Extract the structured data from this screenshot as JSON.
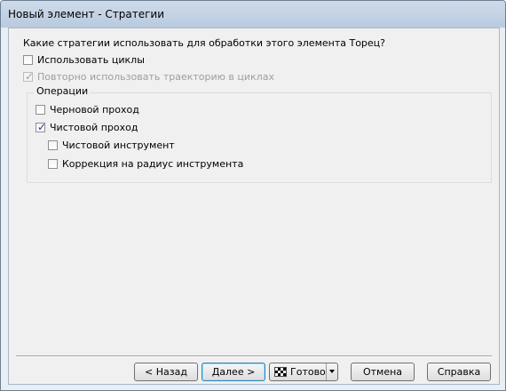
{
  "window": {
    "title": "Новый элемент - Стратегии"
  },
  "question": "Какие стратегии использовать для обработки этого элемента Торец?",
  "options": {
    "use_cycles": {
      "label": "Использовать циклы",
      "checked": false
    },
    "reuse_path": {
      "label": "Повторно использовать траекторию в циклах",
      "checked": true,
      "disabled": true
    }
  },
  "operations": {
    "legend": "Операции",
    "rough": {
      "label": "Черновой проход",
      "checked": false
    },
    "finish": {
      "label": "Чистовой проход",
      "checked": true
    },
    "finish_tool": {
      "label": "Чистовой инструмент",
      "checked": false
    },
    "radius_comp": {
      "label": "Коррекция на радиус инструмента",
      "checked": false
    }
  },
  "buttons": {
    "back": "< Назад",
    "next": "Далее >",
    "finish": "Готово",
    "cancel": "Отмена",
    "help": "Справка"
  }
}
